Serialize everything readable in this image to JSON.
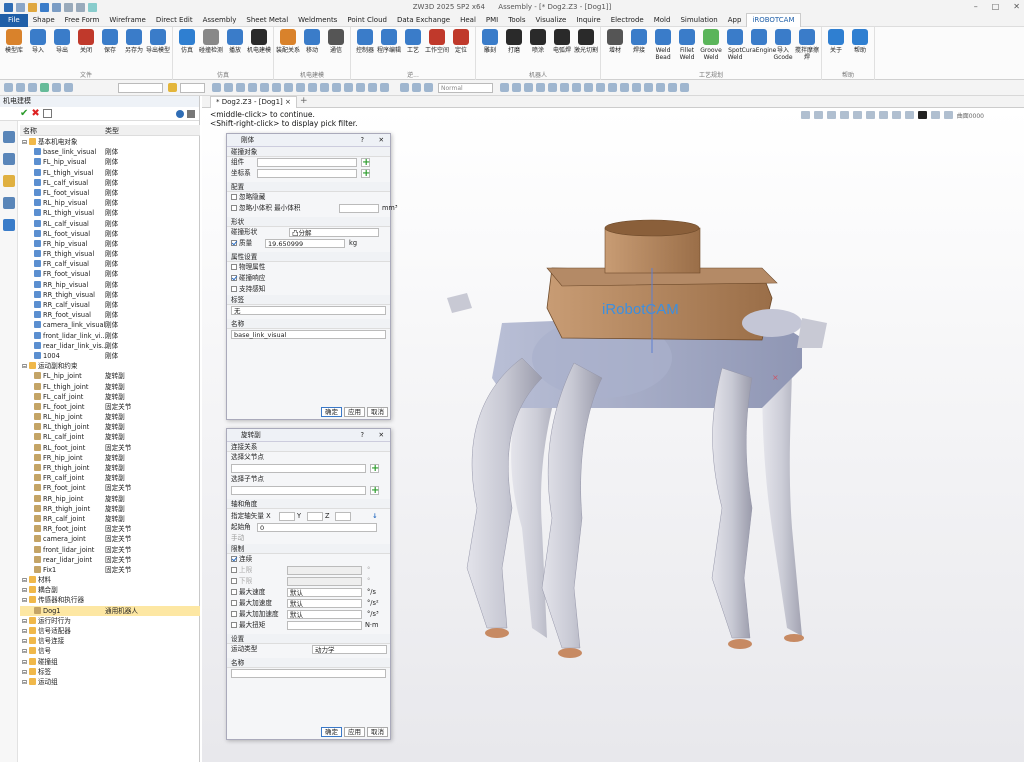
{
  "window": {
    "title": "ZW3D 2025 SP2 x64",
    "doc": "Assembly - [* Dog2.Z3 - [Dog1]]",
    "controls": [
      "–",
      "□",
      "✕"
    ]
  },
  "menu": [
    "File",
    "Shape",
    "Free Form",
    "Wireframe",
    "Direct Edit",
    "Assembly",
    "Sheet Metal",
    "Weldments",
    "Point Cloud",
    "Data Exchange",
    "Heal",
    "PMI",
    "Tools",
    "Visualize",
    "Inquire",
    "Electrode",
    "Mold",
    "Simulation",
    "App",
    "iROBOTCAM"
  ],
  "ribbon": {
    "groups": [
      {
        "name": "文件",
        "buttons": [
          "模型库",
          "导入",
          "导出",
          "关闭",
          "保存",
          "另存为",
          "导出模型"
        ],
        "colors": [
          "#d9822b",
          "#3a7cc9",
          "#3a7cc9",
          "#c0392b",
          "#3a7cc9",
          "#3a7cc9",
          "#3a7cc9"
        ]
      },
      {
        "name": "仿真",
        "buttons": [
          "仿真",
          "碰撞检测",
          "播放",
          "机电建模"
        ],
        "colors": [
          "#2f7fd1",
          "#888",
          "#3a7cc9",
          "#2a2a2a"
        ]
      },
      {
        "name": "机电建模",
        "buttons": [
          "装配关系",
          "移动",
          "通信"
        ],
        "colors": [
          "#d9822b",
          "#3a7cc9",
          "#555"
        ]
      },
      {
        "name": "逆...",
        "buttons": [
          "控制器",
          "程序编辑",
          "工艺",
          "工作空间",
          "定位"
        ],
        "colors": [
          "#3a7cc9",
          "#3a7cc9",
          "#3a7cc9",
          "#c0392b",
          "#c0392b"
        ]
      },
      {
        "name": "机器人",
        "buttons": [
          "雕刻",
          "打磨",
          "喷涂",
          "电弧焊",
          "激光切割"
        ],
        "colors": [
          "#3a7cc9",
          "#2a2a2a",
          "#2a2a2a",
          "#2a2a2a",
          "#2a2a2a"
        ]
      },
      {
        "name": "工艺规划",
        "buttons": [
          "增材",
          "焊接",
          "Weld Bead",
          "Fillet Weld",
          "Groove Weld",
          "Spot Weld",
          "CuraEngine",
          "导入Gcode",
          "搅拌摩擦焊"
        ],
        "colors": [
          "#555",
          "#3a7cc9",
          "#3a7cc9",
          "#3a7cc9",
          "#5ab55a",
          "#3a7cc9",
          "#3a7cc9",
          "#3a7cc9",
          "#3a7cc9"
        ]
      },
      {
        "name": "帮助",
        "buttons": [
          "关于",
          "帮助"
        ],
        "colors": [
          "#2f7fd1",
          "#2f7fd1"
        ]
      }
    ]
  },
  "toolbar2": {
    "style_combo": "Normal",
    "filter_combo": ""
  },
  "left_panel": {
    "title": "机电建模",
    "columns": {
      "name": "名称",
      "type": "类型"
    },
    "tree": [
      {
        "indent": 0,
        "icon": "folder",
        "name": "基本机电对象",
        "type": ""
      },
      {
        "indent": 1,
        "icon": "body",
        "name": "base_link_visual",
        "type": "刚体"
      },
      {
        "indent": 1,
        "icon": "body",
        "name": "FL_hip_visual",
        "type": "刚体"
      },
      {
        "indent": 1,
        "icon": "body",
        "name": "FL_thigh_visual",
        "type": "刚体"
      },
      {
        "indent": 1,
        "icon": "body",
        "name": "FL_calf_visual",
        "type": "刚体"
      },
      {
        "indent": 1,
        "icon": "body",
        "name": "FL_foot_visual",
        "type": "刚体"
      },
      {
        "indent": 1,
        "icon": "body",
        "name": "RL_hip_visual",
        "type": "刚体"
      },
      {
        "indent": 1,
        "icon": "body",
        "name": "RL_thigh_visual",
        "type": "刚体"
      },
      {
        "indent": 1,
        "icon": "body",
        "name": "RL_calf_visual",
        "type": "刚体"
      },
      {
        "indent": 1,
        "icon": "body",
        "name": "RL_foot_visual",
        "type": "刚体"
      },
      {
        "indent": 1,
        "icon": "body",
        "name": "FR_hip_visual",
        "type": "刚体"
      },
      {
        "indent": 1,
        "icon": "body",
        "name": "FR_thigh_visual",
        "type": "刚体"
      },
      {
        "indent": 1,
        "icon": "body",
        "name": "FR_calf_visual",
        "type": "刚体"
      },
      {
        "indent": 1,
        "icon": "body",
        "name": "FR_foot_visual",
        "type": "刚体"
      },
      {
        "indent": 1,
        "icon": "body",
        "name": "RR_hip_visual",
        "type": "刚体"
      },
      {
        "indent": 1,
        "icon": "body",
        "name": "RR_thigh_visual",
        "type": "刚体"
      },
      {
        "indent": 1,
        "icon": "body",
        "name": "RR_calf_visual",
        "type": "刚体"
      },
      {
        "indent": 1,
        "icon": "body",
        "name": "RR_foot_visual",
        "type": "刚体"
      },
      {
        "indent": 1,
        "icon": "body",
        "name": "camera_link_visual",
        "type": "刚体"
      },
      {
        "indent": 1,
        "icon": "body",
        "name": "front_lidar_link_vi...",
        "type": "刚体"
      },
      {
        "indent": 1,
        "icon": "body",
        "name": "rear_lidar_link_vis...",
        "type": "刚体"
      },
      {
        "indent": 1,
        "icon": "body",
        "name": "1004",
        "type": "刚体"
      },
      {
        "indent": 0,
        "icon": "folder",
        "name": "运动副和约束",
        "type": ""
      },
      {
        "indent": 1,
        "icon": "joint",
        "name": "FL_hip_joint",
        "type": "旋转副"
      },
      {
        "indent": 1,
        "icon": "joint",
        "name": "FL_thigh_joint",
        "type": "旋转副"
      },
      {
        "indent": 1,
        "icon": "joint",
        "name": "FL_calf_joint",
        "type": "旋转副"
      },
      {
        "indent": 1,
        "icon": "joint",
        "name": "FL_foot_joint",
        "type": "固定关节"
      },
      {
        "indent": 1,
        "icon": "joint",
        "name": "RL_hip_joint",
        "type": "旋转副"
      },
      {
        "indent": 1,
        "icon": "joint",
        "name": "RL_thigh_joint",
        "type": "旋转副"
      },
      {
        "indent": 1,
        "icon": "joint",
        "name": "RL_calf_joint",
        "type": "旋转副"
      },
      {
        "indent": 1,
        "icon": "joint",
        "name": "RL_foot_joint",
        "type": "固定关节"
      },
      {
        "indent": 1,
        "icon": "joint",
        "name": "FR_hip_joint",
        "type": "旋转副"
      },
      {
        "indent": 1,
        "icon": "joint",
        "name": "FR_thigh_joint",
        "type": "旋转副"
      },
      {
        "indent": 1,
        "icon": "joint",
        "name": "FR_calf_joint",
        "type": "旋转副"
      },
      {
        "indent": 1,
        "icon": "joint",
        "name": "FR_foot_joint",
        "type": "固定关节"
      },
      {
        "indent": 1,
        "icon": "joint",
        "name": "RR_hip_joint",
        "type": "旋转副"
      },
      {
        "indent": 1,
        "icon": "joint",
        "name": "RR_thigh_joint",
        "type": "旋转副"
      },
      {
        "indent": 1,
        "icon": "joint",
        "name": "RR_calf_joint",
        "type": "旋转副"
      },
      {
        "indent": 1,
        "icon": "joint",
        "name": "RR_foot_joint",
        "type": "固定关节"
      },
      {
        "indent": 1,
        "icon": "joint",
        "name": "camera_joint",
        "type": "固定关节"
      },
      {
        "indent": 1,
        "icon": "joint",
        "name": "front_lidar_joint",
        "type": "固定关节"
      },
      {
        "indent": 1,
        "icon": "joint",
        "name": "rear_lidar_joint",
        "type": "固定关节"
      },
      {
        "indent": 1,
        "icon": "joint",
        "name": "Fix1",
        "type": "固定关节"
      },
      {
        "indent": 0,
        "icon": "folder",
        "name": "材料",
        "type": ""
      },
      {
        "indent": 0,
        "icon": "folder",
        "name": "耦合副",
        "type": ""
      },
      {
        "indent": 0,
        "icon": "folder",
        "name": "传感器和执行器",
        "type": ""
      },
      {
        "indent": 1,
        "icon": "joint",
        "name": "Dog1",
        "type": "通用机器人",
        "selected": true
      },
      {
        "indent": 0,
        "icon": "folder",
        "name": "运行时行为",
        "type": ""
      },
      {
        "indent": 0,
        "icon": "folder",
        "name": "信号适配器",
        "type": ""
      },
      {
        "indent": 0,
        "icon": "folder",
        "name": "信号连接",
        "type": ""
      },
      {
        "indent": 0,
        "icon": "folder",
        "name": "信号",
        "type": ""
      },
      {
        "indent": 0,
        "icon": "folder",
        "name": "碰撞组",
        "type": ""
      },
      {
        "indent": 0,
        "icon": "folder",
        "name": "标签",
        "type": ""
      },
      {
        "indent": 0,
        "icon": "folder",
        "name": "运动组",
        "type": ""
      }
    ]
  },
  "doc_tab": "* Dog2.Z3 - [Dog1]",
  "viewport": {
    "hint1": "<middle-click> to continue.",
    "hint2": "<Shift-right-click> to display pick filter.",
    "zoom_label": "曲面0000",
    "brand_text": "iRobotCAM"
  },
  "dialog_rigid": {
    "title": "刚体",
    "sec_collision": "碰撞对象",
    "lbl_component": "组件",
    "lbl_coord": "坐标系",
    "sec_config": "配置",
    "chk_ignore_hidden": "忽略隐藏",
    "chk_ignore_small": "忽略小体积",
    "lbl_min_volume": "最小体积",
    "unit_mm3": "mm³",
    "sec_shape": "形状",
    "lbl_collision_shape": "碰撞形状",
    "val_collision_shape": "凸分解",
    "chk_mass": "质量",
    "val_mass": "19.650999",
    "unit_kg": "kg",
    "sec_props": "属性设置",
    "chk_physics": "物理属性",
    "chk_collision_resp": "碰撞响应",
    "chk_support": "支持感知",
    "sec_label": "标签",
    "val_label": "无",
    "sec_name": "名称",
    "val_name": "base_link_visual",
    "btn_ok": "确定",
    "btn_apply": "应用",
    "btn_cancel": "取消"
  },
  "dialog_joint": {
    "title": "旋转副",
    "sec_connect": "连接关系",
    "lbl_parent": "选择父节点",
    "lbl_child": "选择子节点",
    "sec_axis": "轴和角度",
    "lbl_axis_vec": "指定轴矢量 X",
    "lbl_y": "Y",
    "lbl_z": "Z",
    "lbl_start_angle": "起始角",
    "val_start_angle": "0",
    "lbl_scrolled": "手动  ",
    "sec_limit": "限制",
    "chk_continuous": "连续",
    "lbl_upper": "上限",
    "lbl_lower": "下限",
    "unit_deg": "°",
    "lbl_max_vel": "最大速度",
    "lbl_max_acc": "最大加速度",
    "lbl_max_jerk": "最大加加速度",
    "lbl_max_torque": "最大扭矩",
    "val_default": "默认",
    "unit_vel": "°/s",
    "unit_acc": "°/s²",
    "unit_jerk": "°/s³",
    "unit_torque": "N·m",
    "sec_settings": "设置",
    "lbl_motion_type": "运动类型",
    "val_motion_type": "动力学",
    "sec_name": "名称",
    "btn_ok": "确定",
    "btn_apply": "应用",
    "btn_cancel": "取消"
  }
}
